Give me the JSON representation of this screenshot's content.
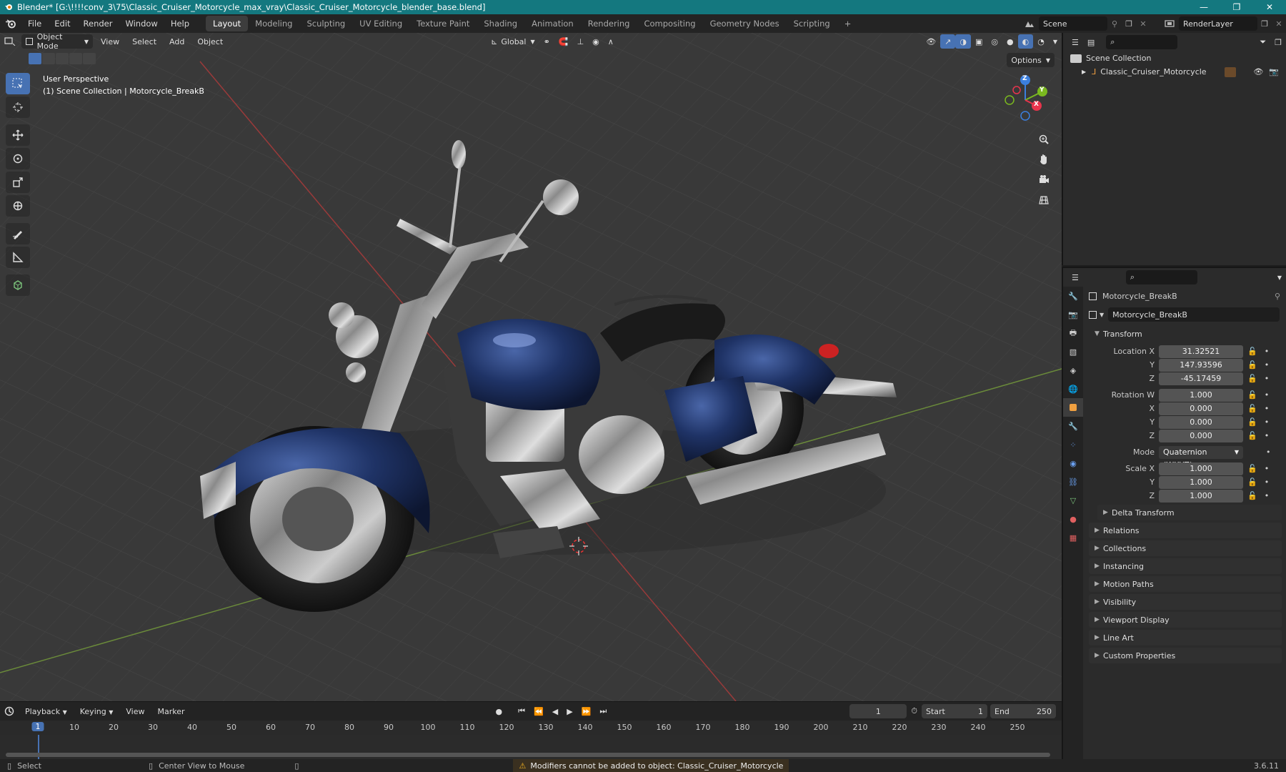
{
  "window": {
    "title": "Blender* [G:\\!!!!conv_3\\75\\Classic_Cruiser_Motorcycle_max_vray\\Classic_Cruiser_Motorcycle_blender_base.blend]",
    "controls": [
      "—",
      "❐",
      "✕"
    ]
  },
  "menu": [
    "File",
    "Edit",
    "Render",
    "Window",
    "Help"
  ],
  "workspaces": [
    "Layout",
    "Modeling",
    "Sculpting",
    "UV Editing",
    "Texture Paint",
    "Shading",
    "Animation",
    "Rendering",
    "Compositing",
    "Geometry Nodes",
    "Scripting"
  ],
  "active_workspace": "Layout",
  "add_workspace": "+",
  "scene": {
    "name": "Scene",
    "render_layer": "RenderLayer"
  },
  "viewport": {
    "mode": "Object Mode",
    "menus": [
      "View",
      "Select",
      "Add",
      "Object"
    ],
    "orientation": "Global",
    "options_label": "Options",
    "info_line1": "User Perspective",
    "info_line2": "(1) Scene Collection | Motorcycle_BreakB",
    "axis": {
      "x": "X",
      "y": "Y",
      "z": "Z"
    }
  },
  "outliner": {
    "root": "Scene Collection",
    "items": [
      {
        "label": "Classic_Cruiser_Motorcycle"
      }
    ]
  },
  "properties": {
    "object_name": "Motorcycle_BreakB",
    "data_name": "Motorcycle_BreakB",
    "transform_label": "Transform",
    "location_label": "Location X",
    "rotation_label": "Rotation W",
    "mode_label": "Mode",
    "scale_label": "Scale X",
    "location": [
      "31.32521",
      "147.93596",
      "-45.17459"
    ],
    "rotation": [
      "1.000",
      "0.000",
      "0.000",
      "0.000"
    ],
    "rotation_mode": "Quaternion (WXYZ)",
    "scale": [
      "1.000",
      "1.000",
      "1.000"
    ],
    "axis_labels": [
      "Y",
      "Z",
      "X"
    ],
    "delta": "Delta Transform",
    "panels": [
      "Relations",
      "Collections",
      "Instancing",
      "Motion Paths",
      "Visibility",
      "Viewport Display",
      "Line Art",
      "Custom Properties"
    ]
  },
  "timeline": {
    "menus": [
      "Playback",
      "Keying",
      "View",
      "Marker"
    ],
    "current_frame": "1",
    "start_label": "Start",
    "start": "1",
    "end_label": "End",
    "end": "250",
    "ticks": [
      "10",
      "20",
      "30",
      "40",
      "50",
      "60",
      "70",
      "80",
      "90",
      "100",
      "110",
      "120",
      "130",
      "140",
      "150",
      "160",
      "170",
      "180",
      "190",
      "200",
      "210",
      "220",
      "230",
      "240",
      "250"
    ],
    "ruler_current": "1"
  },
  "status": {
    "select": "Select",
    "center": "Center View to Mouse",
    "warning": "Modifiers cannot be added to object: Classic_Cruiser_Motorcycle",
    "version": "3.6.11"
  },
  "colors": {
    "accent": "#4772b3",
    "titlebar": "#14787f",
    "motorcycle_paint": "#1f3366"
  }
}
